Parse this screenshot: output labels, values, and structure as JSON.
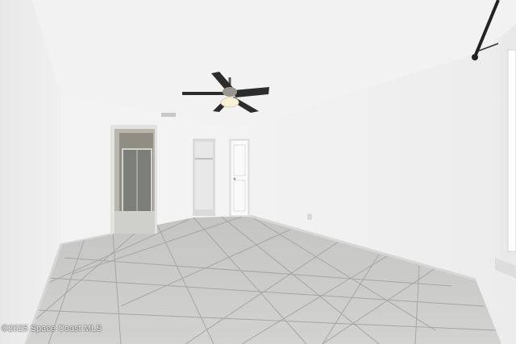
{
  "photo": {
    "watermark": "©2025 Space Coast MLS",
    "colors": {
      "ceiling": "#f2f2f2",
      "wall_light": "#f4f4f4",
      "wall_shadow": "#e6e6e6",
      "floor_tile": "#c9c9c7",
      "grout": "#9e9e9c",
      "fan_blade": "#2c2c2c",
      "door": "#fafafa",
      "baseboard": "#dcdcdc"
    },
    "icons": [
      "ceiling-fan-icon",
      "light-fixture-icon",
      "door-icon",
      "shower-icon",
      "curtain-rod-icon",
      "outlet-icon"
    ]
  }
}
